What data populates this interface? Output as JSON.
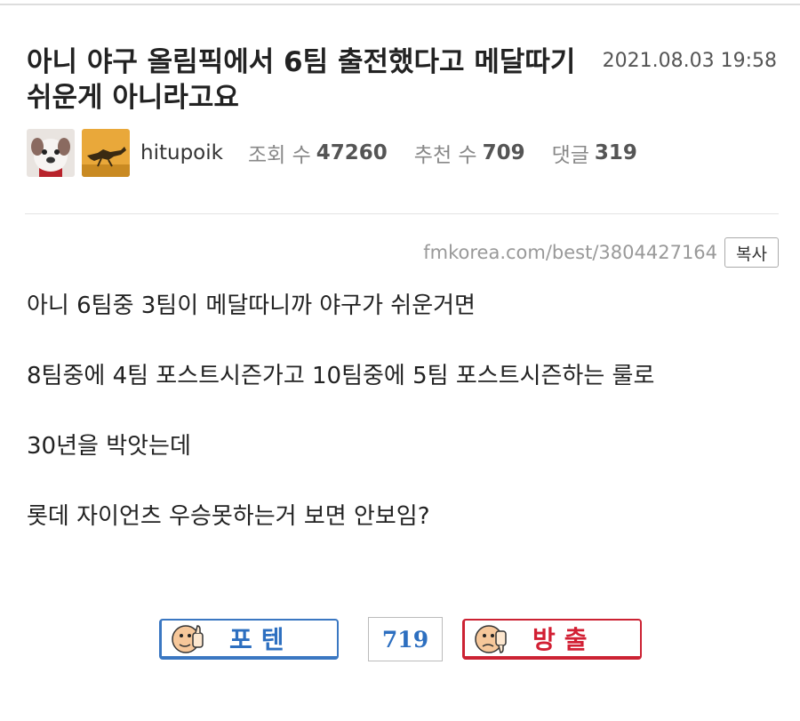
{
  "post": {
    "title": "아니 야구 올림픽에서 6팀 출전했다고 메달따기 쉬운게 아니라고요",
    "date": "2021.08.03 19:58",
    "author": "hitupoik",
    "stats": {
      "views_label": "조회 수",
      "views": "47260",
      "recommend_label": "추천 수",
      "recommend": "709",
      "comments_label": "댓글",
      "comments": "319"
    },
    "url": "fmkorea.com/best/3804427164",
    "copy_label": "복사",
    "body": [
      "아니 6팀중 3팀이 메달따니까 야구가 쉬운거면",
      "8팀중에 4팀 포스트시즌가고 10팀중에 5팀 포스트시즌하는 룰로",
      "30년을 박앗는데",
      "롯데 자이언츠 우승못하는거 보면 안보임?"
    ]
  },
  "votes": {
    "up_label": "포텐",
    "count": "719",
    "down_label": "방출"
  },
  "colors": {
    "up_accent": "#3a77c2",
    "down_accent": "#cc2233",
    "count_text": "#2d6fc0"
  },
  "icons": {
    "avatar_1": "dog-face-icon",
    "avatar_2": "running-animal-icon",
    "vote_up_icon": "thumbs-up-face-icon",
    "vote_down_icon": "thumbs-down-face-icon"
  }
}
